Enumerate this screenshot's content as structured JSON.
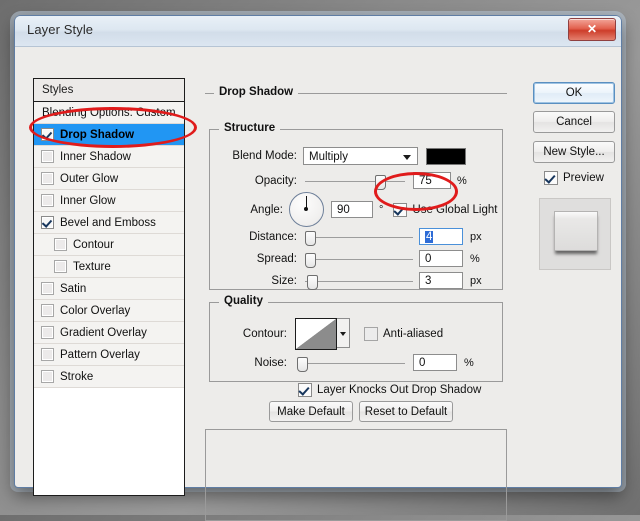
{
  "window": {
    "title": "Layer Style",
    "close_label": "✕"
  },
  "styles_panel": {
    "header": "Styles",
    "items": [
      {
        "label": "Blending Options: Custom",
        "checkbox": "none",
        "indent": false,
        "selected": false
      },
      {
        "label": "Drop Shadow",
        "checkbox": "checked",
        "indent": false,
        "selected": true
      },
      {
        "label": "Inner Shadow",
        "checkbox": "empty",
        "indent": false,
        "selected": false
      },
      {
        "label": "Outer Glow",
        "checkbox": "empty",
        "indent": false,
        "selected": false
      },
      {
        "label": "Inner Glow",
        "checkbox": "empty",
        "indent": false,
        "selected": false
      },
      {
        "label": "Bevel and Emboss",
        "checkbox": "checked",
        "indent": false,
        "selected": false
      },
      {
        "label": "Contour",
        "checkbox": "empty",
        "indent": true,
        "selected": false
      },
      {
        "label": "Texture",
        "checkbox": "empty",
        "indent": true,
        "selected": false
      },
      {
        "label": "Satin",
        "checkbox": "empty",
        "indent": false,
        "selected": false
      },
      {
        "label": "Color Overlay",
        "checkbox": "empty",
        "indent": false,
        "selected": false
      },
      {
        "label": "Gradient Overlay",
        "checkbox": "empty",
        "indent": false,
        "selected": false
      },
      {
        "label": "Pattern Overlay",
        "checkbox": "empty",
        "indent": false,
        "selected": false
      },
      {
        "label": "Stroke",
        "checkbox": "empty",
        "indent": false,
        "selected": false
      }
    ]
  },
  "drop_shadow": {
    "legend": "Drop Shadow",
    "structure": {
      "legend": "Structure",
      "blend_mode_label": "Blend Mode:",
      "blend_mode_value": "Multiply",
      "shadow_color": "#000000",
      "opacity_label": "Opacity:",
      "opacity_value": "75",
      "opacity_unit": "%",
      "angle_label": "Angle:",
      "angle_value": "90",
      "angle_unit": "°",
      "use_global_light_label": "Use Global Light",
      "use_global_light_checked": true,
      "distance_label": "Distance:",
      "distance_value": "4",
      "distance_unit": "px",
      "spread_label": "Spread:",
      "spread_value": "0",
      "spread_unit": "%",
      "size_label": "Size:",
      "size_value": "3",
      "size_unit": "px"
    },
    "quality": {
      "legend": "Quality",
      "contour_label": "Contour:",
      "anti_aliased_label": "Anti-aliased",
      "anti_aliased_checked": false,
      "noise_label": "Noise:",
      "noise_value": "0",
      "noise_unit": "%"
    },
    "knockout": {
      "label": "Layer Knocks Out Drop Shadow",
      "checked": true
    },
    "make_default_label": "Make Default",
    "reset_default_label": "Reset to Default"
  },
  "buttons": {
    "ok": "OK",
    "cancel": "Cancel",
    "new_style": "New Style...",
    "preview_label": "Preview",
    "preview_checked": true
  },
  "annotations": {
    "color": "#e01b1b",
    "highlight_drop_shadow": "Drop Shadow",
    "highlight_distance": "4"
  }
}
